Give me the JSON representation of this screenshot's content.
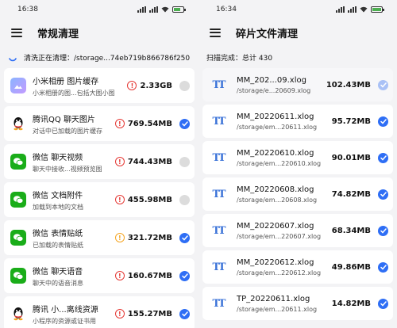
{
  "left": {
    "status_time": "16:38",
    "title": "常规清理",
    "progress_text": "清洗正在清理：/storage...74eb719b866786f250",
    "items": [
      {
        "app": "小米相册",
        "category": "图片缓存",
        "desc": "小米相册的图...包括大图小图",
        "size": "2.33GB",
        "icon": "gallery-icon",
        "warn": "red",
        "check": "off"
      },
      {
        "app": "腾讯QQ",
        "category": "聊天图片",
        "desc": "对话中已加载的图片缓存",
        "size": "769.54MB",
        "icon": "qq-icon",
        "warn": "red",
        "check": "on"
      },
      {
        "app": "微信",
        "category": "聊天视频",
        "desc": "聊天中接收...视频预览图",
        "size": "744.43MB",
        "icon": "wechat-icon",
        "warn": "red",
        "check": "off"
      },
      {
        "app": "微信",
        "category": "文档附件",
        "desc": "加载到本地的文档",
        "size": "455.98MB",
        "icon": "wechat-icon",
        "warn": "red",
        "check": "off"
      },
      {
        "app": "微信",
        "category": "表情贴纸",
        "desc": "已加载的表情贴纸",
        "size": "321.72MB",
        "icon": "wechat-icon",
        "warn": "orange",
        "check": "on"
      },
      {
        "app": "微信",
        "category": "聊天语音",
        "desc": "聊天中的语音消息",
        "size": "160.67MB",
        "icon": "wechat-icon",
        "warn": "red",
        "check": "on"
      },
      {
        "app": "腾讯",
        "category": "小...离线资源",
        "desc": "小程序的资源或证书用",
        "size": "155.27MB",
        "icon": "qq-icon",
        "warn": "red",
        "check": "on"
      }
    ]
  },
  "right": {
    "status_time": "16:34",
    "title": "碎片文件清理",
    "scan_text": "扫描完成：总计 430",
    "items": [
      {
        "name": "MM_202...09.xlog",
        "path": "/storage/e...20609.xlog",
        "size": "102.43MB",
        "check": "light"
      },
      {
        "name": "MM_20220611.xlog",
        "path": "/storage/em...20611.xlog",
        "size": "95.72MB",
        "check": "on"
      },
      {
        "name": "MM_20220610.xlog",
        "path": "/storage/em...220610.xlog",
        "size": "90.01MB",
        "check": "on"
      },
      {
        "name": "MM_20220608.xlog",
        "path": "/storage/em...20608.xlog",
        "size": "74.82MB",
        "check": "on"
      },
      {
        "name": "MM_20220607.xlog",
        "path": "/storage/em...220607.xlog",
        "size": "68.34MB",
        "check": "on"
      },
      {
        "name": "MM_20220612.xlog",
        "path": "/storage/em...220612.xlog",
        "size": "49.86MB",
        "check": "on"
      },
      {
        "name": "TP_20220611.xlog",
        "path": "/storage/em...20611.xlog",
        "size": "14.82MB",
        "check": "on"
      }
    ]
  },
  "colors": {
    "accent": "#2e6ef5",
    "warn_red": "#e53935",
    "warn_orange": "#f5a623",
    "wechat": "#1aad19",
    "file_icon": "#3b73d8"
  },
  "labels": {
    "warn_glyph": "!",
    "file_glyph": "TT"
  }
}
